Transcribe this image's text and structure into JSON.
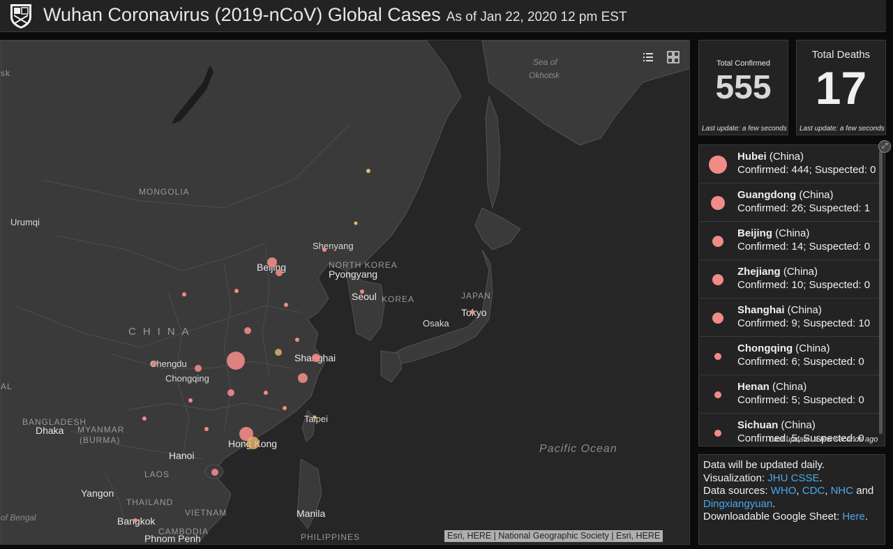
{
  "header": {
    "title": "Wuhan Coronavirus (2019-nCoV) Global Cases",
    "subtitle": "As of Jan 22, 2020 12 pm EST",
    "logo_icon": "university-shield-icon"
  },
  "map": {
    "labels": {
      "sk": "sk",
      "sea_of_okhotsk_1": "Sea of",
      "sea_of_okhotsk_2": "Okhotsk",
      "mongolia": "MONGOLIA",
      "urumqi": "Urumqi",
      "shenyang": "Shenyang",
      "beijing": "Beijing",
      "north_korea": "NORTH KOREA",
      "pyongyang": "Pyongyang",
      "seoul": "Seoul",
      "south_korea": "KOREA",
      "japan": "JAPAN",
      "tokyo": "Tokyo",
      "osaka": "Osaka",
      "china": "CHINA",
      "chengdu": "Chengdu",
      "chongqing": "Chongqing",
      "shanghai": "Shanghai",
      "al": "AL",
      "bangladesh": "BANGLADESH",
      "dhaka": "Dhaka",
      "myanmar": "MYANMAR",
      "burma": "(BURMA)",
      "taipei": "Taipei",
      "hong_kong": "Hong Kong",
      "hanoi": "Hanoi",
      "laos": "LAOS",
      "pacific_ocean": "Pacific Ocean",
      "yangon": "Yangon",
      "thailand": "THAILAND",
      "vietnam": "VIETNAM",
      "bay_of_bengal": "of Bengal",
      "bangkok": "Bangkok",
      "cambodia": "CAMBODIA",
      "phnom_penh": "Phnom Penh",
      "manila": "Manila",
      "philippines": "PHILIPPINES"
    },
    "tools": {
      "list_icon": "list-icon",
      "qr_icon": "grid-icon"
    },
    "attribution": "Esri, HERE | National Geographic Society | Esri, HERE",
    "colors": {
      "bubble": "#f08b86",
      "bubble_yellow": "#e8b770",
      "land": "#3a3a3a",
      "water": "#262626"
    }
  },
  "stats": {
    "confirmed": {
      "label": "Total Confirmed",
      "value": "555",
      "update": "Last update: a few seconds ago"
    },
    "deaths": {
      "label": "Total Deaths",
      "value": "17",
      "update": "Last update: a few seconds ago"
    }
  },
  "list": {
    "expand_icon": "expand-icon",
    "rows": [
      {
        "name": "Hubei",
        "country": " (China)",
        "stats": "Confirmed: 444; Suspected: 0"
      },
      {
        "name": "Guangdong",
        "country": " (China)",
        "stats": "Confirmed: 26; Suspected: 1"
      },
      {
        "name": "Beijing",
        "country": " (China)",
        "stats": "Confirmed: 14; Suspected: 0"
      },
      {
        "name": "Zhejiang",
        "country": " (China)",
        "stats": "Confirmed: 10; Suspected: 0"
      },
      {
        "name": "Shanghai",
        "country": " (China)",
        "stats": "Confirmed: 9; Suspected: 10"
      },
      {
        "name": "Chongqing",
        "country": " (China)",
        "stats": "Confirmed: 6; Suspected: 0"
      },
      {
        "name": "Henan",
        "country": " (China)",
        "stats": "Confirmed: 5; Suspected: 0"
      },
      {
        "name": "Sichuan",
        "country": " (China)",
        "stats": "Confirmed: 5; Suspected: 0"
      }
    ],
    "update": "Last update: a few seconds ago"
  },
  "info": {
    "line1": "Data will be updated daily.",
    "viz_prefix": "Visualization: ",
    "viz_link": "JHU CSSE",
    "viz_suffix": ".",
    "src_prefix": "Data sources: ",
    "src_who": "WHO",
    "sep1": ", ",
    "src_cdc": "CDC",
    "sep2": ", ",
    "src_nhc": "NHC",
    "src_and": " and",
    "src_dxy": "Dingxiangyuan",
    "src_end": ".",
    "sheet_prefix": "Downloadable Google Sheet: ",
    "sheet_link": "Here",
    "sheet_end": "."
  }
}
